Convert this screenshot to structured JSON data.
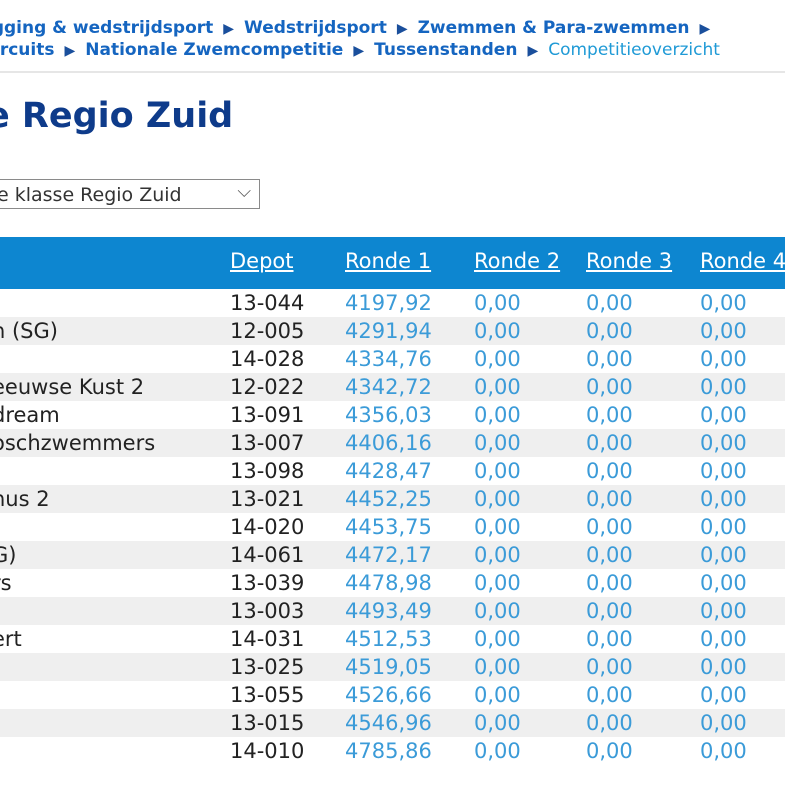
{
  "breadcrumb": {
    "line1": [
      "igging & wedstrijdsport",
      "Wedstrijdsport",
      "Zwemmen & Para-zwemmen"
    ],
    "line2": [
      "ircuits",
      "Nationale Zwemcompetitie",
      "Tussenstanden"
    ],
    "current": "Competitieoverzicht",
    "separator": "▶"
  },
  "page_title": "e Regio Zuid",
  "class_select": {
    "value": "e klasse Regio Zuid",
    "chevron": "⌵"
  },
  "table": {
    "headers": {
      "depot": "Depot",
      "r1": "Ronde 1",
      "r2": "Ronde 2",
      "r3": "Ronde 3",
      "r4": "Ronde 4"
    },
    "rows": [
      {
        "name": "",
        "depot": "13-044",
        "r1": "4197,92",
        "r2": "0,00",
        "r3": "0,00",
        "r4": "0,00"
      },
      {
        "name": "n (SG)",
        "depot": "12-005",
        "r1": "4291,94",
        "r2": "0,00",
        "r3": "0,00",
        "r4": "0,00"
      },
      {
        "name": "",
        "depot": "14-028",
        "r1": "4334,76",
        "r2": "0,00",
        "r3": "0,00",
        "r4": "0,00"
      },
      {
        "name": "eeuwse Kust 2",
        "depot": "12-022",
        "r1": "4342,72",
        "r2": "0,00",
        "r3": "0,00",
        "r4": "0,00"
      },
      {
        "name": "dream",
        "depot": "13-091",
        "r1": "4356,03",
        "r2": "0,00",
        "r3": "0,00",
        "r4": "0,00"
      },
      {
        "name": "oschzwemmers",
        "depot": "13-007",
        "r1": "4406,16",
        "r2": "0,00",
        "r3": "0,00",
        "r4": "0,00"
      },
      {
        "name": "",
        "depot": "13-098",
        "r1": "4428,47",
        "r2": "0,00",
        "r3": "0,00",
        "r4": "0,00"
      },
      {
        "name": "nus 2",
        "depot": "13-021",
        "r1": "4452,25",
        "r2": "0,00",
        "r3": "0,00",
        "r4": "0,00"
      },
      {
        "name": "",
        "depot": "14-020",
        "r1": "4453,75",
        "r2": "0,00",
        "r3": "0,00",
        "r4": "0,00"
      },
      {
        "name": "G)",
        "depot": "14-061",
        "r1": "4472,17",
        "r2": "0,00",
        "r3": "0,00",
        "r4": "0,00"
      },
      {
        "name": "rs",
        "depot": "13-039",
        "r1": "4478,98",
        "r2": "0,00",
        "r3": "0,00",
        "r4": "0,00"
      },
      {
        "name": "",
        "depot": "13-003",
        "r1": "4493,49",
        "r2": "0,00",
        "r3": "0,00",
        "r4": "0,00"
      },
      {
        "name": "ert",
        "depot": "14-031",
        "r1": "4512,53",
        "r2": "0,00",
        "r3": "0,00",
        "r4": "0,00"
      },
      {
        "name": "",
        "depot": "13-025",
        "r1": "4519,05",
        "r2": "0,00",
        "r3": "0,00",
        "r4": "0,00"
      },
      {
        "name": "",
        "depot": "13-055",
        "r1": "4526,66",
        "r2": "0,00",
        "r3": "0,00",
        "r4": "0,00"
      },
      {
        "name": "",
        "depot": "13-015",
        "r1": "4546,96",
        "r2": "0,00",
        "r3": "0,00",
        "r4": "0,00"
      },
      {
        "name": "",
        "depot": "14-010",
        "r1": "4785,86",
        "r2": "0,00",
        "r3": "0,00",
        "r4": "0,00"
      }
    ]
  },
  "colors": {
    "link": "#1565c0",
    "header_bg": "#0d86d0",
    "title": "#0e3b8a",
    "score": "#3b9bd8",
    "row_alt": "#efefef"
  }
}
